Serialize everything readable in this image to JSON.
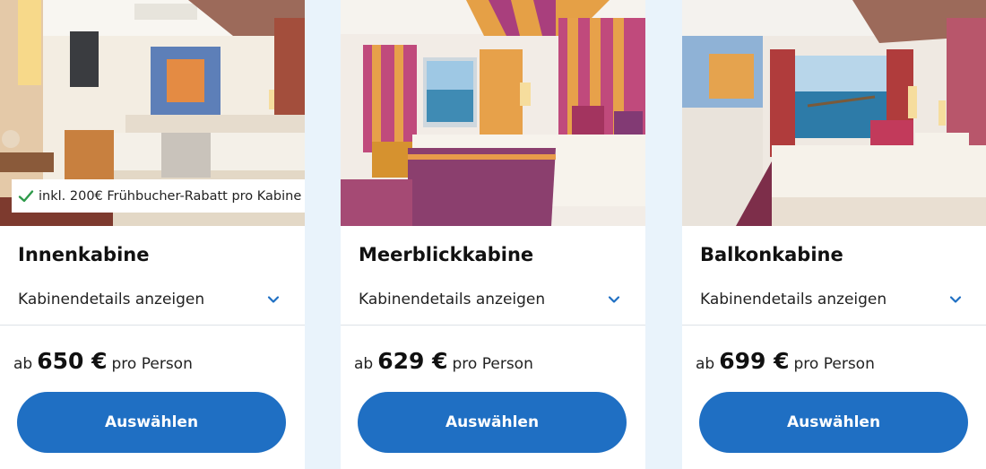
{
  "colors": {
    "page_background": "#e9f3fb",
    "button": "#1f6fc3",
    "chevron": "#1f6fc3",
    "check": "#2e9a4a"
  },
  "cabins": [
    {
      "title": "Innenkabine",
      "details_label": "Kabinendetails anzeigen",
      "price_prefix": "ab",
      "price": "650 €",
      "price_suffix": "pro Person",
      "button_label": "Auswählen",
      "badge": "inkl. 200€ Frühbucher-Rabatt pro Kabine"
    },
    {
      "title": "Meerblickkabine",
      "details_label": "Kabinendetails anzeigen",
      "price_prefix": "ab",
      "price": "629 €",
      "price_suffix": "pro Person",
      "button_label": "Auswählen"
    },
    {
      "title": "Balkonkabine",
      "details_label": "Kabinendetails anzeigen",
      "price_prefix": "ab",
      "price": "699 €",
      "price_suffix": "pro Person",
      "button_label": "Auswählen"
    }
  ]
}
